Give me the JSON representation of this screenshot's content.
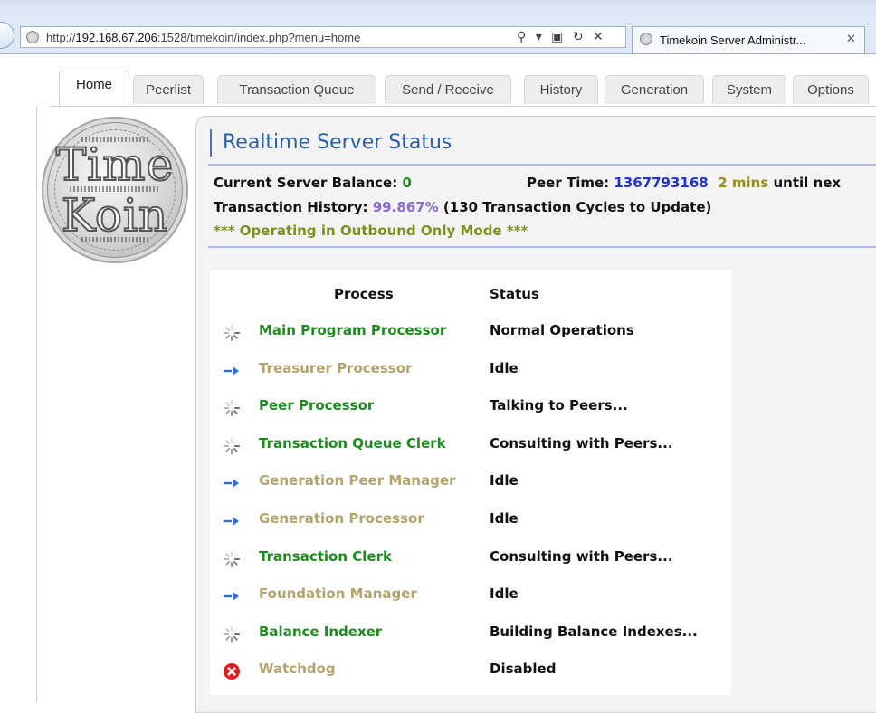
{
  "browser": {
    "url_prefix": "http://",
    "url_host": "192.168.67.206",
    "url_rest": ":1528/timekoin/index.php?menu=home",
    "url_controls": "⚲ ▾ ▣ ↻ ✕",
    "tab_title": "Timekoin Server Administr...",
    "tab_close": "✕"
  },
  "nav": {
    "tabs": [
      {
        "label": "Home",
        "active": true
      },
      {
        "label": "Peerlist"
      },
      {
        "label": "Transaction Queue"
      },
      {
        "label": "Send / Receive"
      },
      {
        "label": "History"
      },
      {
        "label": "Generation"
      },
      {
        "label": "System"
      },
      {
        "label": "Options"
      }
    ]
  },
  "logo": {
    "top": "Time",
    "bottom": "Koin"
  },
  "status": {
    "title": "Realtime Server Status",
    "balance_label": "Current Server Balance:",
    "balance_value": "0",
    "peer_time_label": "Peer Time:",
    "peer_time_value": "1367793168",
    "mins_value": "2 mins",
    "mins_suffix": "until nex",
    "history_label": "Transaction History:",
    "history_value": "99.867%",
    "history_note": "(130 Transaction Cycles to Update)",
    "mode_notice": "*** Operating in Outbound Only Mode ***"
  },
  "process_table": {
    "headers": {
      "process": "Process",
      "status": "Status"
    },
    "rows": [
      {
        "icon": "spinner-icon",
        "name": "Main Program Processor",
        "status": "Normal Operations",
        "state": "active"
      },
      {
        "icon": "arrow-right-icon",
        "name": "Treasurer Processor",
        "status": "Idle",
        "state": "idle"
      },
      {
        "icon": "spinner-icon",
        "name": "Peer Processor",
        "status": "Talking to Peers...",
        "state": "active"
      },
      {
        "icon": "spinner-icon",
        "name": "Transaction Queue Clerk",
        "status": "Consulting with Peers...",
        "state": "active"
      },
      {
        "icon": "arrow-right-icon",
        "name": "Generation Peer Manager",
        "status": "Idle",
        "state": "idle"
      },
      {
        "icon": "arrow-right-icon",
        "name": "Generation Processor",
        "status": "Idle",
        "state": "idle"
      },
      {
        "icon": "spinner-icon",
        "name": "Transaction Clerk",
        "status": "Consulting with Peers...",
        "state": "active"
      },
      {
        "icon": "arrow-right-icon",
        "name": "Foundation Manager",
        "status": "Idle",
        "state": "idle"
      },
      {
        "icon": "spinner-icon",
        "name": "Balance Indexer",
        "status": "Building Balance Indexes...",
        "state": "active"
      },
      {
        "icon": "error-x-icon",
        "name": "Watchdog",
        "status": "Disabled",
        "state": "idle"
      }
    ]
  },
  "colors": {
    "active_process": "#1f8a1f",
    "idle_process": "#b1a46c",
    "title_blue": "#2c5f9e",
    "peer_time": "#2233cc",
    "history_pct": "#8a6ccb",
    "mode_notice": "#7f8f1d",
    "error_red": "#e02020",
    "arrow_blue": "#2b6fd6"
  }
}
